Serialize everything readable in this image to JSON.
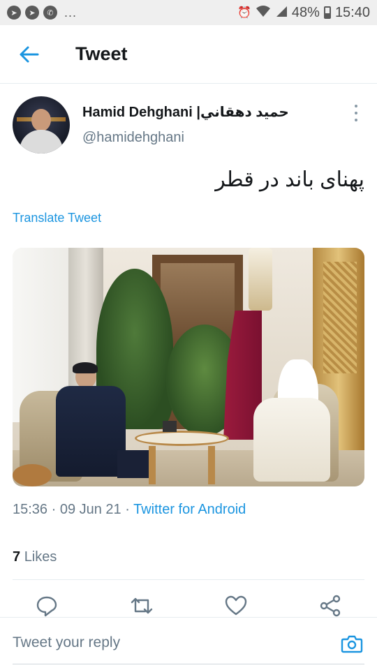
{
  "status_bar": {
    "battery": "48%",
    "time": "15:40",
    "dots": "..."
  },
  "header": {
    "title": "Tweet"
  },
  "tweet": {
    "author_name": "Hamid Dehghani |حمید دهقاني",
    "handle": "@hamidehghani",
    "text": "پهنای باند در قطر",
    "translate_label": "Translate Tweet",
    "time": "15:36 · 09 Jun 21 · ",
    "app": "Twitter for Android",
    "likes_count": "7",
    "likes_label": "Likes"
  },
  "reply": {
    "placeholder": "Tweet your reply"
  },
  "colors": {
    "accent": "#1b95e0",
    "text_secondary": "#657786"
  },
  "icons": [
    "telegram-icon",
    "telegram-icon",
    "whatsapp-icon",
    "alarm-icon",
    "wifi-icon",
    "signal-icon",
    "battery-icon",
    "back-arrow-icon",
    "more-vertical-icon",
    "reply-icon",
    "retweet-icon",
    "like-icon",
    "share-icon",
    "camera-icon"
  ]
}
